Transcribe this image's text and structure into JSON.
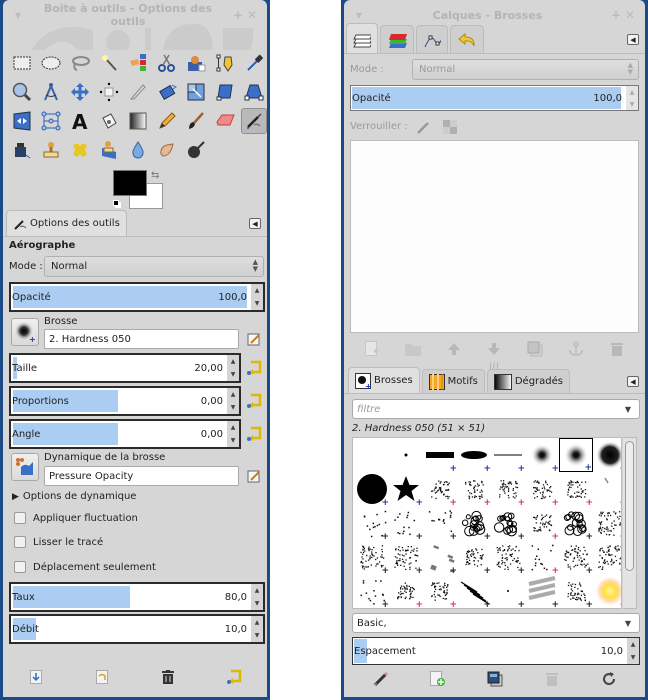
{
  "toolbox": {
    "title": "Boîte à outils - Options des outils",
    "tools_row1": [
      "rect-select",
      "ellipse-select",
      "free-select",
      "fuzzy-select",
      "select-by-color",
      "scissors-select",
      "foreground-select",
      "paths",
      "color-picker"
    ],
    "tools_row2": [
      "zoom",
      "measure",
      "move",
      "alignment",
      "crop",
      "rotate",
      "scale",
      "shear",
      "perspective"
    ],
    "tools_row3": [
      "flip",
      "cage-transform",
      "text",
      "bucket-fill",
      "blend",
      "pencil",
      "paintbrush",
      "eraser",
      "airbrush"
    ],
    "tools_row4": [
      "ink",
      "clone",
      "heal",
      "perspective-clone",
      "blur",
      "smudge",
      "dodge-burn"
    ],
    "active_tool": "airbrush",
    "fg_color": "#000000",
    "bg_color": "#ffffff"
  },
  "tool_options": {
    "tab_label": "Options des outils",
    "tool_name": "Aérographe",
    "mode_label": "Mode :",
    "mode_value": "Normal",
    "opacity": {
      "label": "Opacité",
      "value": "100,0",
      "fraction": 1.0
    },
    "brush_label": "Brosse",
    "brush_value": "2. Hardness 050",
    "size": {
      "label": "Taille",
      "value": "20,00",
      "fraction": 0.02
    },
    "aspect": {
      "label": "Proportions",
      "value": "0,00",
      "fraction": 0.5
    },
    "angle": {
      "label": "Angle",
      "value": "0,00",
      "fraction": 0.5
    },
    "dynamics_label": "Dynamique de la brosse",
    "dynamics_value": "Pressure Opacity",
    "dynamics_options": "Options de dynamique",
    "checkboxes": [
      {
        "label": "Appliquer fluctuation",
        "checked": false
      },
      {
        "label": "Lisser le tracé",
        "checked": false
      },
      {
        "label": "Déplacement seulement",
        "checked": false
      }
    ],
    "rate": {
      "label": "Taux",
      "value": "80,0",
      "fraction": 0.5
    },
    "flow": {
      "label": "Débit",
      "value": "10,0",
      "fraction": 0.1
    },
    "bottom_buttons": [
      "save-options",
      "restore-options",
      "delete-options",
      "reset-options"
    ]
  },
  "layers_dock": {
    "title": "Calques - Brosses",
    "tabs": [
      "layers",
      "channels",
      "paths",
      "undo-history"
    ],
    "mode_label": "Mode :",
    "mode_value": "Normal",
    "opacity": {
      "label": "Opacité",
      "value": "100,0",
      "fraction": 1.0
    },
    "lock_label": "Verrouiller :",
    "bottom_buttons": [
      "new-layer",
      "new-layer-group",
      "raise-layer",
      "lower-layer",
      "duplicate-layer",
      "anchor-layer",
      "delete-layer"
    ]
  },
  "brushes_dock": {
    "tabs": [
      "Brosses",
      "Motifs",
      "Dégradés"
    ],
    "filter_placeholder": "filtre",
    "selected_brush": "2. Hardness 050 (51 × 51)",
    "tag_value": "Basic,",
    "spacing": {
      "label": "Espacement",
      "value": "10,0",
      "fraction": 0.05
    },
    "bottom_buttons": [
      "edit-brush",
      "new-brush",
      "duplicate-brush",
      "delete-brush",
      "refresh-brushes"
    ]
  },
  "colors": {
    "titlebar_bg": "#1b4b86",
    "panel_bg": "#d6d6d6",
    "highlight": "#abcdf2"
  }
}
